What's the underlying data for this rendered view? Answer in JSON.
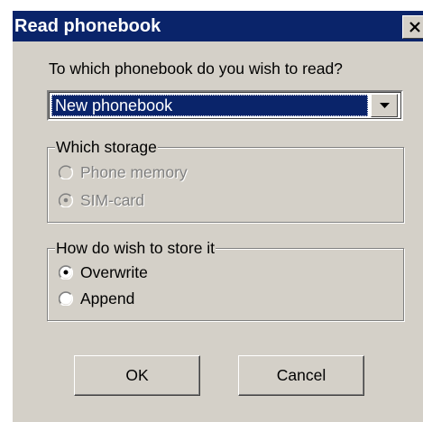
{
  "dialog": {
    "title": "Read phonebook",
    "close_icon": "close-icon"
  },
  "phonebook": {
    "question": "To which phonebook do you wish to read?",
    "selected": "New phonebook",
    "dropdown_icon": "chevron-down-icon"
  },
  "storage": {
    "legend": "Which storage",
    "enabled": false,
    "options": [
      {
        "label": "Phone memory",
        "selected": false
      },
      {
        "label": "SIM-card",
        "selected": true
      }
    ]
  },
  "store_mode": {
    "legend": "How do wish to store it",
    "enabled": true,
    "options": [
      {
        "label": "Overwrite",
        "selected": true
      },
      {
        "label": "Append",
        "selected": false
      }
    ]
  },
  "buttons": {
    "ok": "OK",
    "cancel": "Cancel"
  },
  "colors": {
    "title_bar": "#0a246a",
    "face": "#d4d0c8",
    "selection": "#0a246a"
  }
}
